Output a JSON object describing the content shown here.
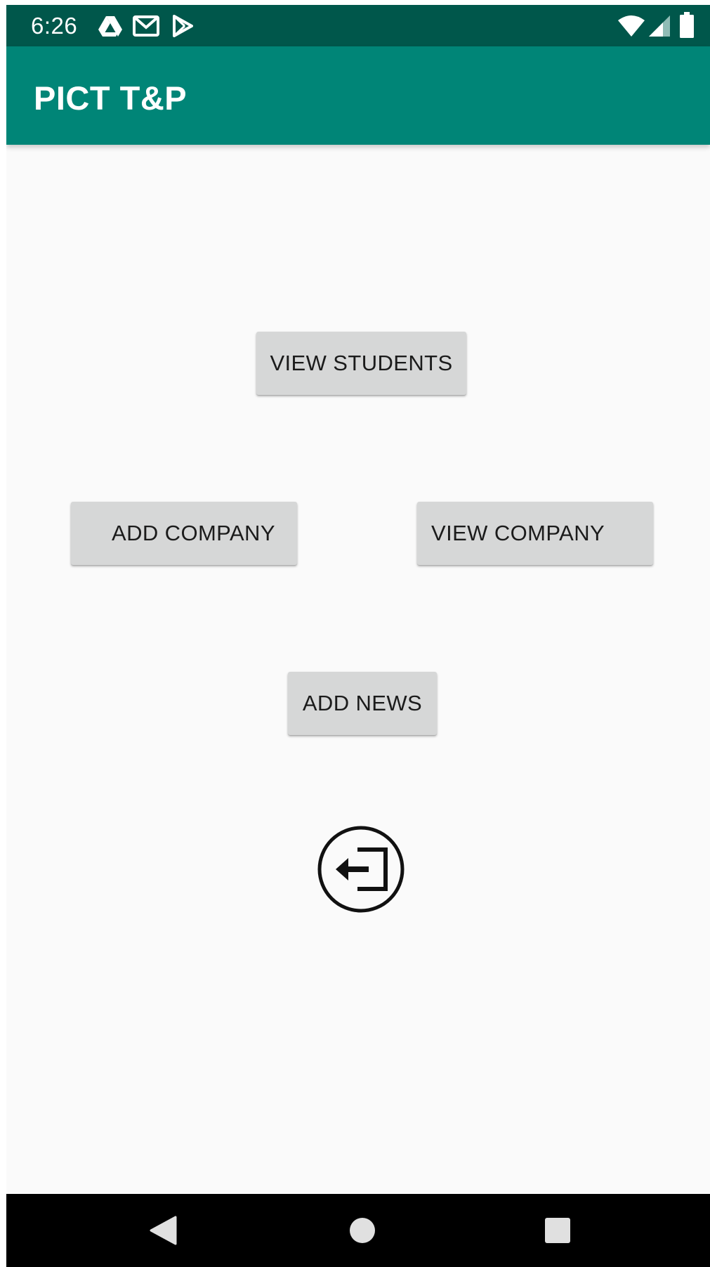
{
  "status_bar": {
    "time": "6:26",
    "notification_icons": [
      "drive-icon",
      "gmail-icon",
      "play-store-icon"
    ],
    "system_icons": [
      "wifi-icon",
      "signal-icon",
      "battery-icon"
    ]
  },
  "app_bar": {
    "title": "PICT T&P",
    "color": "#008577",
    "status_color": "#00574b"
  },
  "buttons": {
    "view_students": "VIEW STUDENTS",
    "add_company": "ADD COMPANY",
    "view_company": "VIEW COMPANY",
    "add_news": "ADD NEWS"
  },
  "logout": {
    "icon": "logout-icon"
  },
  "nav_bar": {
    "icons": [
      "back-icon",
      "home-icon",
      "recents-icon"
    ]
  }
}
